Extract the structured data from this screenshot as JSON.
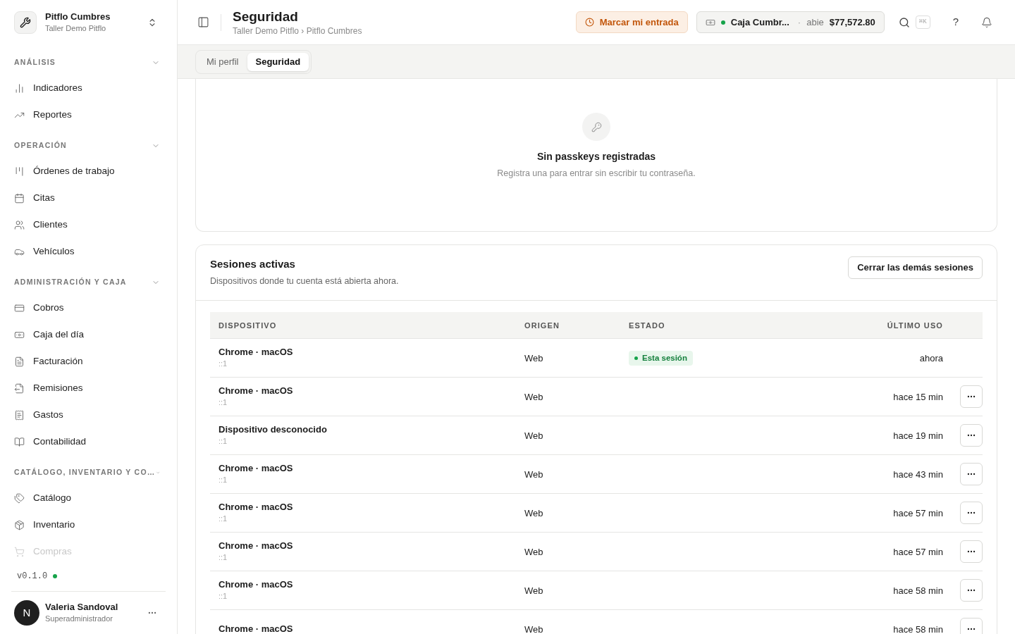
{
  "workspace": {
    "name": "Pitflo Cumbres",
    "subtitle": "Taller Demo Pitflo"
  },
  "sidebar": {
    "sections": [
      {
        "title": "ANÁLISIS",
        "expanded": true,
        "items": [
          "Indicadores",
          "Reportes"
        ]
      },
      {
        "title": "OPERACIÓN",
        "expanded": true,
        "items": [
          "Órdenes de trabajo",
          "Citas",
          "Clientes",
          "Vehículos"
        ]
      },
      {
        "title": "ADMINISTRACIÓN Y CAJA",
        "expanded": true,
        "items": [
          "Cobros",
          "Caja del día",
          "Facturación",
          "Remisiones",
          "Gastos",
          "Contabilidad"
        ]
      },
      {
        "title": "CATÁLOGO, INVENTARIO Y CO…",
        "expanded": true,
        "items": [
          "Catálogo",
          "Inventario",
          "Compras"
        ]
      }
    ],
    "version": "v0.1.0",
    "user": {
      "initial": "N",
      "name": "Valeria Sandoval",
      "role": "Superadministrador"
    }
  },
  "header": {
    "title": "Seguridad",
    "breadcrumb": "Taller Demo Pitflo › Pitflo Cumbres",
    "clock_in": "Marcar mi entrada",
    "register": {
      "name": "Caja Cumbr...",
      "separator": "·",
      "status": "abie",
      "amount": "$77,572.80"
    },
    "shortcut": "⌘K",
    "help": "?"
  },
  "tabs": [
    {
      "label": "Mi perfil",
      "selected": false
    },
    {
      "label": "Seguridad",
      "selected": true
    }
  ],
  "passkeys": {
    "title": "Sin passkeys registradas",
    "description": "Registra una para entrar sin escribir tu contraseña."
  },
  "sessions": {
    "title": "Sesiones activas",
    "description": "Dispositivos donde tu cuenta está abierta ahora.",
    "action": "Cerrar las demás sesiones",
    "columns": [
      "DISPOSITIVO",
      "ORIGEN",
      "ESTADO",
      "ÚLTIMO USO"
    ],
    "rows": [
      {
        "device": "Chrome · macOS",
        "address": "::1",
        "origin": "Web",
        "current": true,
        "status": "Esta sesión",
        "last_used": "ahora"
      },
      {
        "device": "Chrome · macOS",
        "address": "::1",
        "origin": "Web",
        "current": false,
        "last_used": "hace 15 min"
      },
      {
        "device": "Dispositivo desconocido",
        "address": "::1",
        "origin": "Web",
        "current": false,
        "last_used": "hace 19 min"
      },
      {
        "device": "Chrome · macOS",
        "address": "::1",
        "origin": "Web",
        "current": false,
        "last_used": "hace 43 min"
      },
      {
        "device": "Chrome · macOS",
        "address": "::1",
        "origin": "Web",
        "current": false,
        "last_used": "hace 57 min"
      },
      {
        "device": "Chrome · macOS",
        "address": "::1",
        "origin": "Web",
        "current": false,
        "last_used": "hace 57 min"
      },
      {
        "device": "Chrome · macOS",
        "address": "::1",
        "origin": "Web",
        "current": false,
        "last_used": "hace 58 min"
      },
      {
        "device": "Chrome · macOS",
        "origin": "Web",
        "current": false,
        "last_used": "hace 58 min"
      }
    ]
  }
}
